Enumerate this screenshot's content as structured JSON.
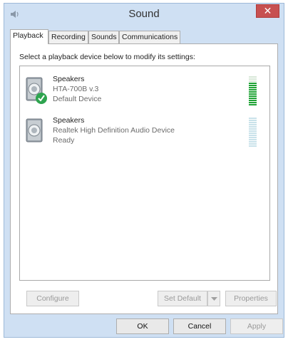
{
  "window": {
    "title": "Sound"
  },
  "tabs": [
    {
      "label": "Playback"
    },
    {
      "label": "Recording"
    },
    {
      "label": "Sounds"
    },
    {
      "label": "Communications"
    }
  ],
  "panel": {
    "instruction": "Select a playback device below to modify its settings:"
  },
  "devices": [
    {
      "name": "Speakers",
      "description": "HTA-700B v.3",
      "status": "Default Device",
      "default": true,
      "level_segments_lit": 11,
      "meter_color": "#1fa335"
    },
    {
      "name": "Speakers",
      "description": "Realtek High Definition Audio Device",
      "status": "Ready",
      "default": false,
      "level_segments_lit": 0,
      "meter_color": "#c9e2ea"
    }
  ],
  "panel_buttons": {
    "configure": "Configure",
    "set_default": "Set Default",
    "properties": "Properties"
  },
  "dialog_buttons": {
    "ok": "OK",
    "cancel": "Cancel",
    "apply": "Apply"
  },
  "colors": {
    "close_button": "#c75050",
    "titlebar": "#cfe0f3",
    "default_check": "#2ea44f"
  }
}
